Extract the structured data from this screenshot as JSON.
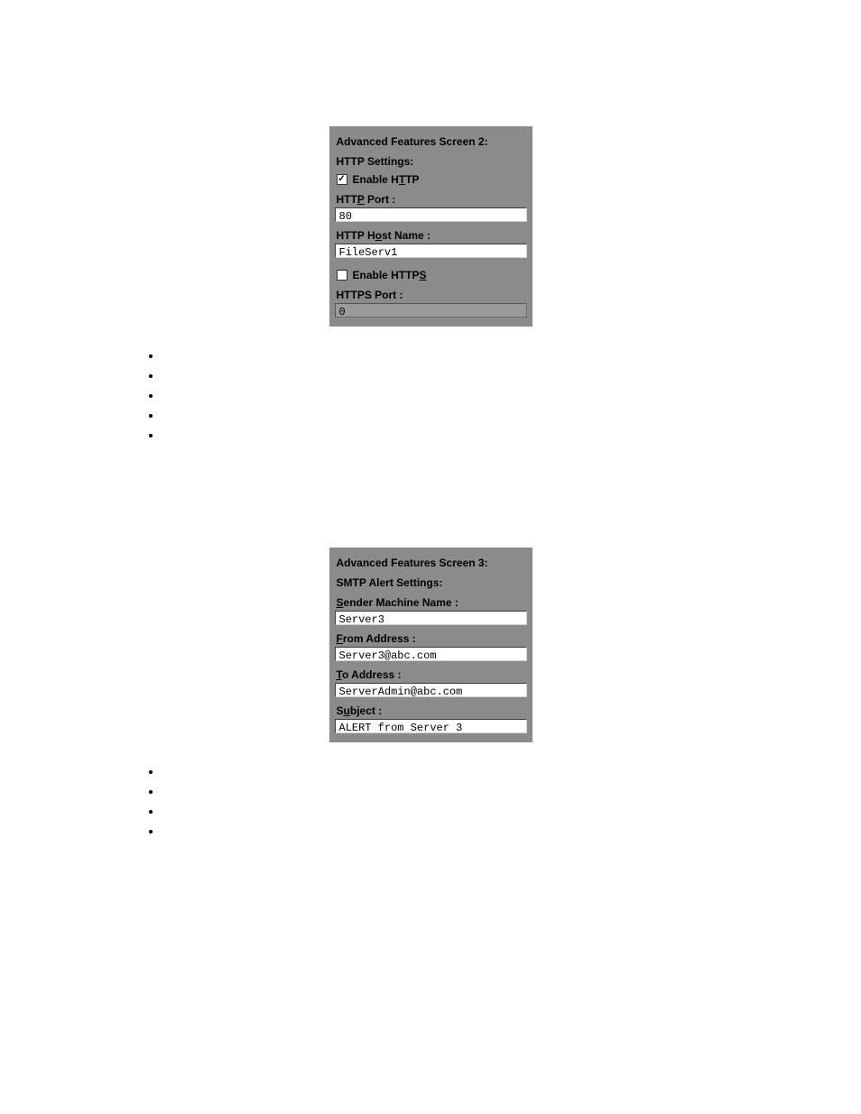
{
  "screen2": {
    "title": "Advanced Features Screen 2:",
    "section": "HTTP Settings:",
    "enable_http_label": "Enable HTTP",
    "enable_http_checked": true,
    "http_port_label": "HTTP Port :",
    "http_port_value": "80",
    "http_host_label": "HTTP Host Name :",
    "http_host_value": "FileServ1",
    "enable_https_label": "Enable HTTPS",
    "enable_https_checked": false,
    "https_port_label": "HTTPS Port :",
    "https_port_value": "0"
  },
  "screen3": {
    "title": "Advanced Features Screen 3:",
    "section": "SMTP Alert Settings:",
    "sender_label": "Sender Machine Name :",
    "sender_value": "Server3",
    "from_label": "From Address :",
    "from_value": "Server3@abc.com",
    "to_label": "To Address :",
    "to_value": "ServerAdmin@abc.com",
    "subject_label": "Subject :",
    "subject_value": "ALERT from Server 3"
  },
  "bullets2": [
    "",
    "",
    "",
    "",
    ""
  ],
  "bullets3": [
    "",
    "",
    "",
    ""
  ]
}
